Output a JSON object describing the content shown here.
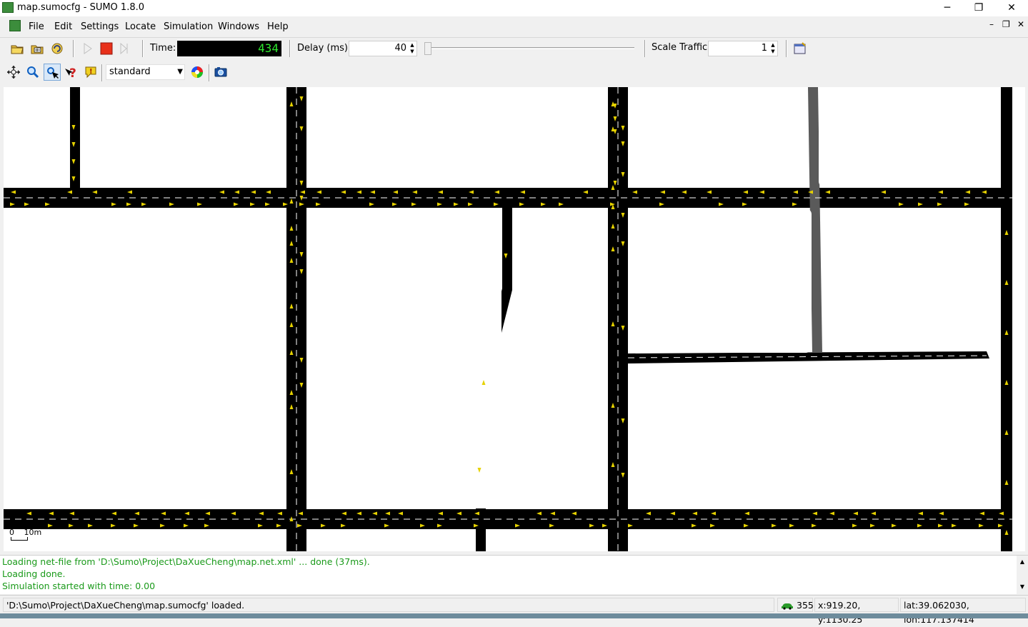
{
  "window": {
    "title": "map.sumocfg - SUMO 1.8.0",
    "minimize": "─",
    "restore": "❐",
    "close": "✕"
  },
  "menu": {
    "items": [
      "File",
      "Edit",
      "Settings",
      "Locate",
      "Simulation",
      "Windows",
      "Help"
    ]
  },
  "mdi_controls": {
    "minimize": "–",
    "restore": "❐",
    "close": "✕"
  },
  "toolbar": {
    "time_label": "Time:",
    "time_value": "434",
    "delay_label": "Delay (ms):",
    "delay_value": "40",
    "scale_label": "Scale Traffic:",
    "scale_value": "1"
  },
  "view_toolbar": {
    "scheme": "standard"
  },
  "canvas": {
    "scale_label_0": "0",
    "scale_label_10": "10m",
    "road_color": "#000000",
    "vehicle_color": "#e6d200",
    "highlight_road_color": "#5a5a5a"
  },
  "log": {
    "lines": [
      "Loading net-file from 'D:\\Sumo\\Project\\DaXueCheng\\map.net.xml' ... done (37ms).",
      "Loading done.",
      "Simulation started with time: 0.00"
    ]
  },
  "status": {
    "message": "'D:\\Sumo\\Project\\DaXueCheng\\map.sumocfg' loaded.",
    "vehicle_count": "355",
    "coords": "x:919.20, y:1130.25",
    "geo": "lat:39.062030, lon:117.137414"
  },
  "icons": [
    "sumo-app-icon",
    "open-folder-icon",
    "open-network-icon",
    "reload-icon",
    "play-icon",
    "stop-icon",
    "step-icon",
    "edit-chosen-icon",
    "recenter-icon",
    "zoom-icon",
    "select-icon",
    "help-query-icon",
    "warning-icon",
    "color-wheel-icon",
    "screenshot-icon",
    "car-icon"
  ]
}
